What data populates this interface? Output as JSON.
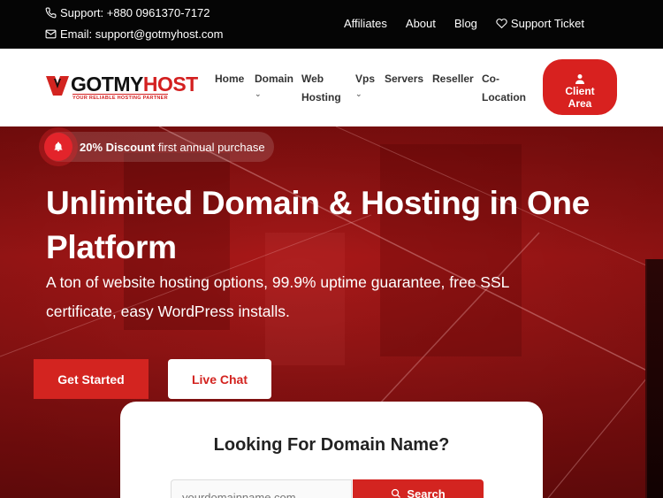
{
  "topbar": {
    "support_phone": "Support: +880 0961370-7172",
    "support_email": "Email: support@gotmyhost.com",
    "links": [
      "Affiliates",
      "About",
      "Blog",
      "Support Ticket"
    ]
  },
  "header": {
    "logo_word_a": "GOTMY",
    "logo_word_b": "HOST",
    "logo_tagline": "YOUR RELIABLE HOSTING PARTNER",
    "nav": {
      "home": "Home",
      "domain": "Domain",
      "web_hosting_1": "Web",
      "web_hosting_2": "Hosting",
      "vps": "Vps",
      "servers": "Servers",
      "reseller": "Reseller",
      "colocation_1": "Co-",
      "colocation_2": "Location"
    },
    "client_area_1": "Client",
    "client_area_2": "Area"
  },
  "hero": {
    "promo_bold": "20% Discount",
    "promo_rest": " first annual purchase",
    "title": "Unlimited Domain & Hosting in One Platform",
    "subtitle": "A ton of website hosting options, 99.9% uptime guarantee, free SSL certificate, easy WordPress installs.",
    "get_started": "Get Started",
    "live_chat": "Live Chat"
  },
  "domain_search": {
    "heading": "Looking For Domain Name?",
    "placeholder": "yourdomainname.com",
    "button": "Search"
  },
  "colors": {
    "brand_red": "#d32420",
    "topbar": "#050505"
  }
}
